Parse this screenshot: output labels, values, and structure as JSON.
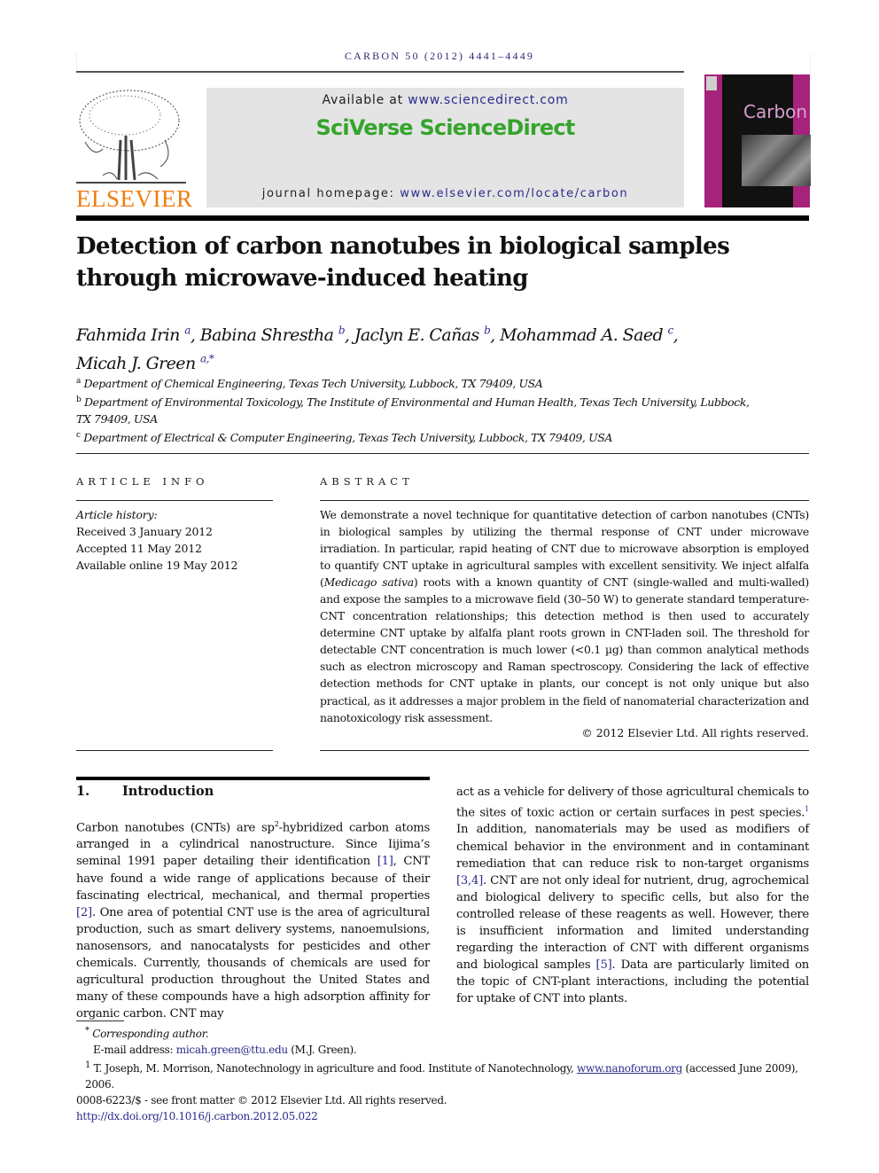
{
  "header": {
    "journal_line": "CARBON 50 (2012) 4441–4449",
    "publisher_wordmark": "ELSEVIER",
    "publisher_logo": "elsevier-tree-icon",
    "available_prefix": "Available at ",
    "available_link": "www.sciencedirect.com",
    "sciverse_brand": "SciVerse ScienceDirect",
    "homepage_prefix": "journal homepage: ",
    "homepage_link": "www.elsevier.com/locate/carbon",
    "cover_title": "Carbon",
    "colors": {
      "elsevier_orange": "#f07d10",
      "sciverse_green": "#35a42c",
      "cover_magenta": "#a5237a",
      "link_blue": "#2b2b8c"
    }
  },
  "article": {
    "title": "Detection of carbon nanotubes in biological samples through microwave-induced heating",
    "authors": [
      {
        "name": "Fahmida Irin",
        "sup": "a",
        "sep": ", "
      },
      {
        "name": "Babina Shrestha",
        "sup": "b",
        "sep": ", "
      },
      {
        "name": "Jaclyn E. Cañas",
        "sup": "b",
        "sep": ", "
      },
      {
        "name": "Mohammad A. Saed",
        "sup": "c",
        "sep": ","
      },
      {
        "name": "Micah J. Green",
        "sup": "a,*",
        "sep": ""
      }
    ],
    "affiliations": [
      {
        "sup": "a",
        "text": "Department of Chemical Engineering, Texas Tech University, Lubbock, TX 79409, USA"
      },
      {
        "sup": "b",
        "text": "Department of Environmental Toxicology, The Institute of Environmental and Human Health, Texas Tech University, Lubbock, TX 79409, USA"
      },
      {
        "sup": "c",
        "text": "Department of Electrical & Computer Engineering, Texas Tech University, Lubbock, TX 79409, USA"
      }
    ]
  },
  "article_info": {
    "heading": "ARTICLE INFO",
    "history_label": "Article history:",
    "received": "Received 3 January 2012",
    "accepted": "Accepted 11 May 2012",
    "online": "Available online 19 May 2012"
  },
  "abstract": {
    "heading": "ABSTRACT",
    "part1": "We demonstrate a novel technique for quantitative detection of carbon nanotubes (CNTs) in biological samples by utilizing the thermal response of CNT under microwave irradiation. In particular, rapid heating of CNT due to microwave absorption is employed to quantify CNT uptake in agricultural samples with excellent sensitivity. We inject alfalfa (",
    "species": "Medicago sativa",
    "part2": ") roots with a known quantity of CNT (single-walled and multi-walled) and expose the samples to a microwave field (30–50 W) to generate standard temperature-CNT concentration relationships; this detection method is then used to accurately determine CNT uptake by alfalfa plant roots grown in CNT-laden soil. The threshold for detectable CNT concentration is much lower (<0.1 µg) than common analytical methods such as electron microscopy and Raman spectroscopy. Considering the lack of effective detection methods for CNT uptake in plants, our concept is not only unique but also practical, as it addresses a major problem in the field of nanomaterial characterization and nanotoxicology risk assessment.",
    "copyright": "© 2012 Elsevier Ltd. All rights reserved."
  },
  "introduction": {
    "number": "1.",
    "heading": "Introduction",
    "left": {
      "t1": "Carbon nanotubes (CNTs) are sp",
      "sup": "2",
      "t2": "-hybridized carbon atoms arranged in a cylindrical nanostructure. Since Iijima’s seminal 1991 paper detailing their identification ",
      "ref1": "[1]",
      "t3": ", CNT have found a wide range of applications because of their fascinating electrical, mechanical, and thermal properties ",
      "ref2": "[2]",
      "t4": ". One area of potential CNT use is the area of agricultural production, such as smart delivery systems, nanoemulsions, nanosensors, and nanocatalysts for pesticides and other chemicals. Currently, thousands of chemicals are used for agricultural production throughout the United States and many of these compounds have a high adsorption affinity for organic carbon. CNT may"
    },
    "right": {
      "t1": "act as a vehicle for delivery of those agricultural chemicals to the sites of toxic action or certain surfaces in pest species.",
      "fn": "1",
      "t2": " In addition, nanomaterials may be used as modifiers of chemical behavior in the environment and in contaminant remediation that can reduce risk to non-target organisms ",
      "ref34": "[3,4]",
      "t3": ". CNT are not only ideal for nutrient, drug, agrochemical and biological delivery to specific cells, but also for the controlled release of these reagents as well. However, there is insufficient information and limited understanding regarding the interaction of CNT with different organisms and biological samples ",
      "ref5": "[5]",
      "t4": ". Data are particularly limited on the topic of CNT-plant interactions, including the potential for uptake of CNT into plants."
    }
  },
  "footnotes": {
    "corr_mark": "*",
    "corr_label": "Corresponding author.",
    "email_label": "E-mail address: ",
    "email": "micah.green@ttu.edu",
    "email_suffix": " (M.J. Green).",
    "fn1_mark": "1",
    "fn1_text": " T. Joseph, M. Morrison, Nanotechnology in agriculture and food. Institute of Nanotechnology, ",
    "fn1_link": "www.nanoforum.org",
    "fn1_suffix": " (accessed June 2009), 2006.",
    "front_matter": "0008-6223/$ - see front matter © 2012 Elsevier Ltd. All rights reserved.",
    "doi": "http://dx.doi.org/10.1016/j.carbon.2012.05.022"
  }
}
